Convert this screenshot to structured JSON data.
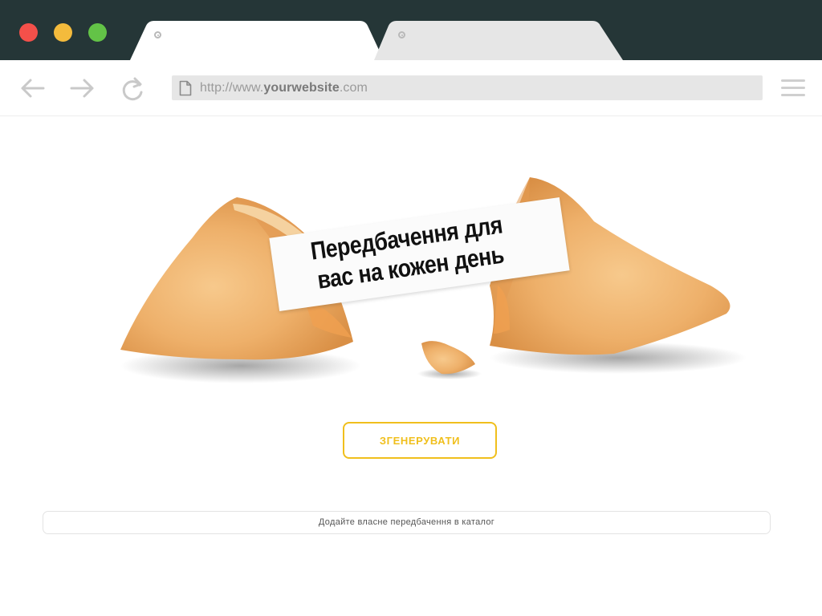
{
  "window": {
    "traffic_lights": {
      "close_color": "#f4504a",
      "minimize_color": "#f4bb3c",
      "maximize_color": "#63c347"
    },
    "chrome_color": "#253637"
  },
  "tabs": [
    {
      "title": "",
      "active": true
    },
    {
      "title": "",
      "active": false
    }
  ],
  "toolbar": {
    "back_icon": "arrow-left-icon",
    "forward_icon": "arrow-right-icon",
    "reload_icon": "reload-icon",
    "menu_icon": "hamburger-menu-icon",
    "url_prefix": "http://www.",
    "url_domain": "yourwebsite",
    "url_suffix": ".com"
  },
  "main": {
    "fortune_line1": "Передбачення для",
    "fortune_line2": "вас на кожен день",
    "generate_label": "ЗГЕНЕРУВАТИ",
    "accent_color": "#f0bf1c",
    "catalog_link": "Додайте власне передбачення в каталог"
  }
}
